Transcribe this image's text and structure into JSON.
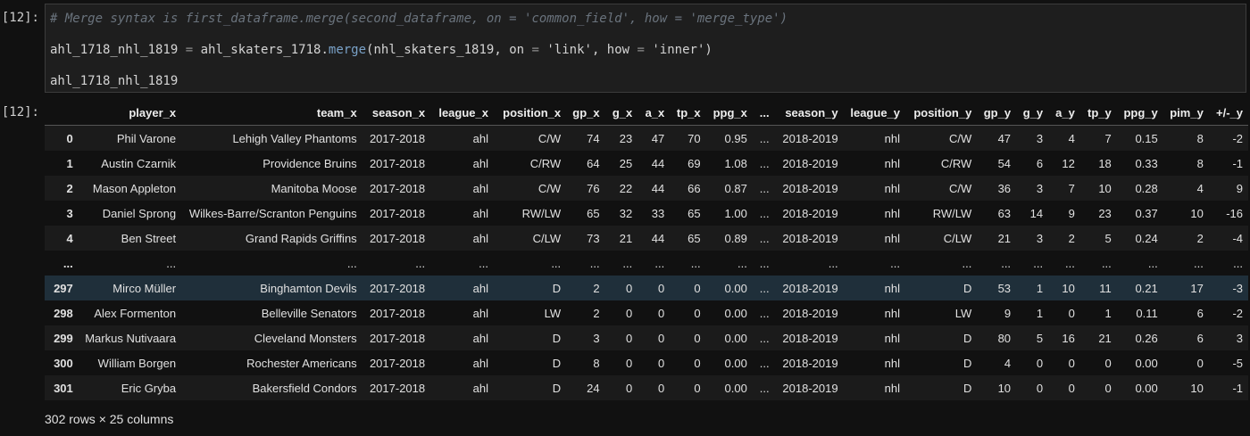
{
  "input_prompt": "[12]:",
  "output_prompt": "[12]:",
  "code": {
    "comment": "# Merge syntax is first_dataframe.merge(second_dataframe, on = 'common_field', how = 'merge_type')",
    "line2": {
      "lhs": "ahl_1718_nhl_1819",
      "eq": " = ",
      "obj": "ahl_skaters_1718.",
      "method": "merge",
      "args_a": "(nhl_skaters_1819, on ",
      "eq2": "=",
      "str1": " 'link'",
      "args_b": ", how ",
      "eq3": "=",
      "str2": " 'inner'",
      "close": ")"
    },
    "line3": "ahl_1718_nhl_1819"
  },
  "table": {
    "columns": [
      "",
      "player_x",
      "team_x",
      "season_x",
      "league_x",
      "position_x",
      "gp_x",
      "g_x",
      "a_x",
      "tp_x",
      "ppg_x",
      "...",
      "season_y",
      "league_y",
      "position_y",
      "gp_y",
      "g_y",
      "a_y",
      "tp_y",
      "ppg_y",
      "pim_y",
      "+/-_y"
    ],
    "rows": [
      [
        "0",
        "Phil Varone",
        "Lehigh Valley Phantoms",
        "2017-2018",
        "ahl",
        "C/W",
        "74",
        "23",
        "47",
        "70",
        "0.95",
        "...",
        "2018-2019",
        "nhl",
        "C/W",
        "47",
        "3",
        "4",
        "7",
        "0.15",
        "8",
        "-2"
      ],
      [
        "1",
        "Austin Czarnik",
        "Providence Bruins",
        "2017-2018",
        "ahl",
        "C/RW",
        "64",
        "25",
        "44",
        "69",
        "1.08",
        "...",
        "2018-2019",
        "nhl",
        "C/RW",
        "54",
        "6",
        "12",
        "18",
        "0.33",
        "8",
        "-1"
      ],
      [
        "2",
        "Mason Appleton",
        "Manitoba Moose",
        "2017-2018",
        "ahl",
        "C/W",
        "76",
        "22",
        "44",
        "66",
        "0.87",
        "...",
        "2018-2019",
        "nhl",
        "C/W",
        "36",
        "3",
        "7",
        "10",
        "0.28",
        "4",
        "9"
      ],
      [
        "3",
        "Daniel Sprong",
        "Wilkes-Barre/Scranton Penguins",
        "2017-2018",
        "ahl",
        "RW/LW",
        "65",
        "32",
        "33",
        "65",
        "1.00",
        "...",
        "2018-2019",
        "nhl",
        "RW/LW",
        "63",
        "14",
        "9",
        "23",
        "0.37",
        "10",
        "-16"
      ],
      [
        "4",
        "Ben Street",
        "Grand Rapids Griffins",
        "2017-2018",
        "ahl",
        "C/LW",
        "73",
        "21",
        "44",
        "65",
        "0.89",
        "...",
        "2018-2019",
        "nhl",
        "C/LW",
        "21",
        "3",
        "2",
        "5",
        "0.24",
        "2",
        "-4"
      ],
      [
        "...",
        "...",
        "...",
        "...",
        "...",
        "...",
        "...",
        "...",
        "...",
        "...",
        "...",
        "...",
        "...",
        "...",
        "...",
        "...",
        "...",
        "...",
        "...",
        "...",
        "...",
        "..."
      ],
      [
        "297",
        "Mirco Müller",
        "Binghamton Devils",
        "2017-2018",
        "ahl",
        "D",
        "2",
        "0",
        "0",
        "0",
        "0.00",
        "...",
        "2018-2019",
        "nhl",
        "D",
        "53",
        "1",
        "10",
        "11",
        "0.21",
        "17",
        "-3"
      ],
      [
        "298",
        "Alex Formenton",
        "Belleville Senators",
        "2017-2018",
        "ahl",
        "LW",
        "2",
        "0",
        "0",
        "0",
        "0.00",
        "...",
        "2018-2019",
        "nhl",
        "LW",
        "9",
        "1",
        "0",
        "1",
        "0.11",
        "6",
        "-2"
      ],
      [
        "299",
        "Markus Nutivaara",
        "Cleveland Monsters",
        "2017-2018",
        "ahl",
        "D",
        "3",
        "0",
        "0",
        "0",
        "0.00",
        "...",
        "2018-2019",
        "nhl",
        "D",
        "80",
        "5",
        "16",
        "21",
        "0.26",
        "6",
        "3"
      ],
      [
        "300",
        "William Borgen",
        "Rochester Americans",
        "2017-2018",
        "ahl",
        "D",
        "8",
        "0",
        "0",
        "0",
        "0.00",
        "...",
        "2018-2019",
        "nhl",
        "D",
        "4",
        "0",
        "0",
        "0",
        "0.00",
        "0",
        "-5"
      ],
      [
        "301",
        "Eric Gryba",
        "Bakersfield Condors",
        "2017-2018",
        "ahl",
        "D",
        "24",
        "0",
        "0",
        "0",
        "0.00",
        "...",
        "2018-2019",
        "nhl",
        "D",
        "10",
        "0",
        "0",
        "0",
        "0.00",
        "10",
        "-1"
      ]
    ],
    "highlighted_row": 6
  },
  "shape_text": "302 rows × 25 columns"
}
